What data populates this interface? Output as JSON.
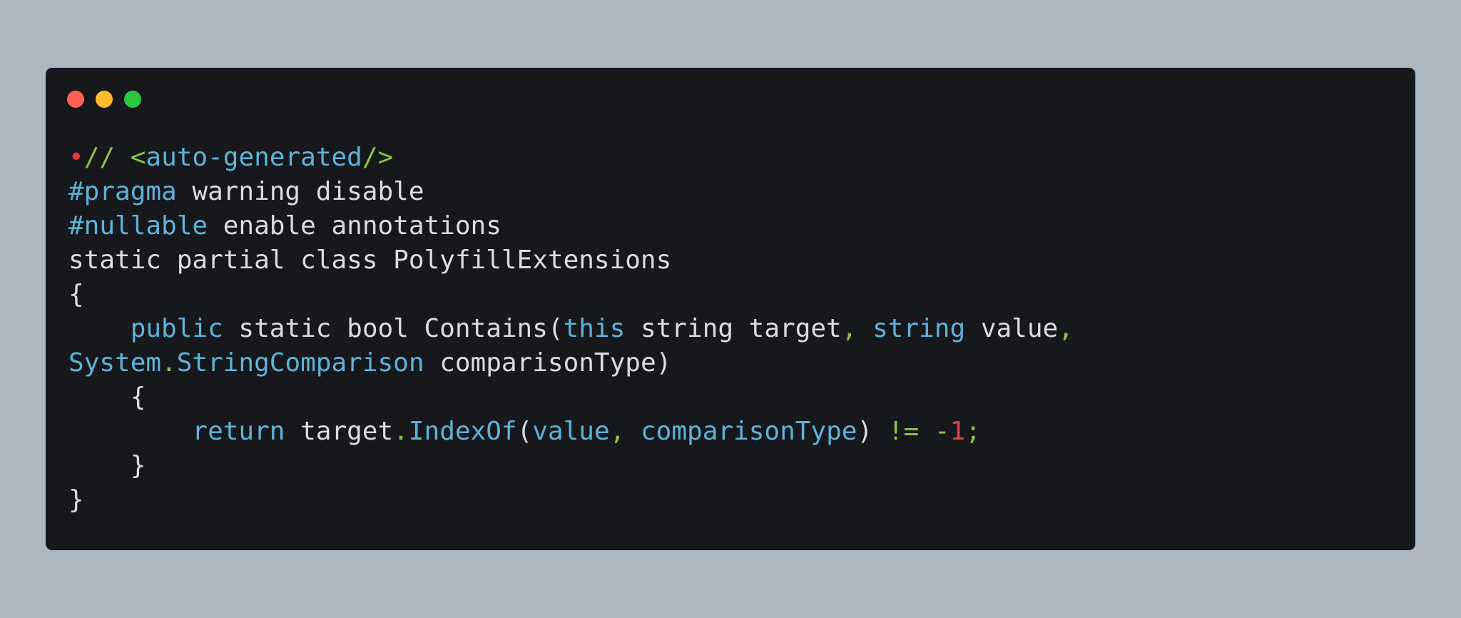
{
  "window": {
    "controls": [
      {
        "name": "close",
        "color": "#ff5f57"
      },
      {
        "name": "minimize",
        "color": "#febc2e"
      },
      {
        "name": "maximize",
        "color": "#28c840"
      }
    ]
  },
  "code": {
    "lines": [
      [
        {
          "text": "•",
          "kind": "marker"
        },
        {
          "text": "// ",
          "kind": "comment"
        },
        {
          "text": "<",
          "kind": "comment"
        },
        {
          "text": "auto-generated",
          "kind": "tag"
        },
        {
          "text": "/>",
          "kind": "comment"
        }
      ],
      [
        {
          "text": "#pragma",
          "kind": "directive"
        },
        {
          "text": " warning disable",
          "kind": "plain"
        }
      ],
      [
        {
          "text": "#nullable",
          "kind": "directive"
        },
        {
          "text": " enable annotations",
          "kind": "plain"
        }
      ],
      [
        {
          "text": "static partial class PolyfillExtensions",
          "kind": "plain"
        }
      ],
      [
        {
          "text": "{",
          "kind": "plain"
        }
      ],
      [
        {
          "text": "    ",
          "kind": "plain"
        },
        {
          "text": "public",
          "kind": "keyword"
        },
        {
          "text": " static bool Contains(",
          "kind": "plain"
        },
        {
          "text": "this",
          "kind": "keyword"
        },
        {
          "text": " string target",
          "kind": "plain"
        },
        {
          "text": ",",
          "kind": "punct"
        },
        {
          "text": " ",
          "kind": "plain"
        },
        {
          "text": "string",
          "kind": "keyword"
        },
        {
          "text": " value",
          "kind": "plain"
        },
        {
          "text": ",",
          "kind": "punct"
        }
      ],
      [
        {
          "text": "System",
          "kind": "type"
        },
        {
          "text": ".",
          "kind": "punct"
        },
        {
          "text": "StringComparison",
          "kind": "type"
        },
        {
          "text": " comparisonType)",
          "kind": "plain"
        }
      ],
      [
        {
          "text": "    {",
          "kind": "plain"
        }
      ],
      [
        {
          "text": "        ",
          "kind": "plain"
        },
        {
          "text": "return",
          "kind": "keyword"
        },
        {
          "text": " target",
          "kind": "plain"
        },
        {
          "text": ".",
          "kind": "punct"
        },
        {
          "text": "IndexOf",
          "kind": "ident"
        },
        {
          "text": "(",
          "kind": "plain"
        },
        {
          "text": "value",
          "kind": "ident"
        },
        {
          "text": ",",
          "kind": "punct"
        },
        {
          "text": " ",
          "kind": "plain"
        },
        {
          "text": "comparisonType",
          "kind": "ident"
        },
        {
          "text": ") ",
          "kind": "plain"
        },
        {
          "text": "!=",
          "kind": "operator"
        },
        {
          "text": " ",
          "kind": "plain"
        },
        {
          "text": "-",
          "kind": "operator"
        },
        {
          "text": "1",
          "kind": "number"
        },
        {
          "text": ";",
          "kind": "punct"
        }
      ],
      [
        {
          "text": "    }",
          "kind": "plain"
        }
      ],
      [
        {
          "text": "}",
          "kind": "plain"
        }
      ]
    ]
  }
}
